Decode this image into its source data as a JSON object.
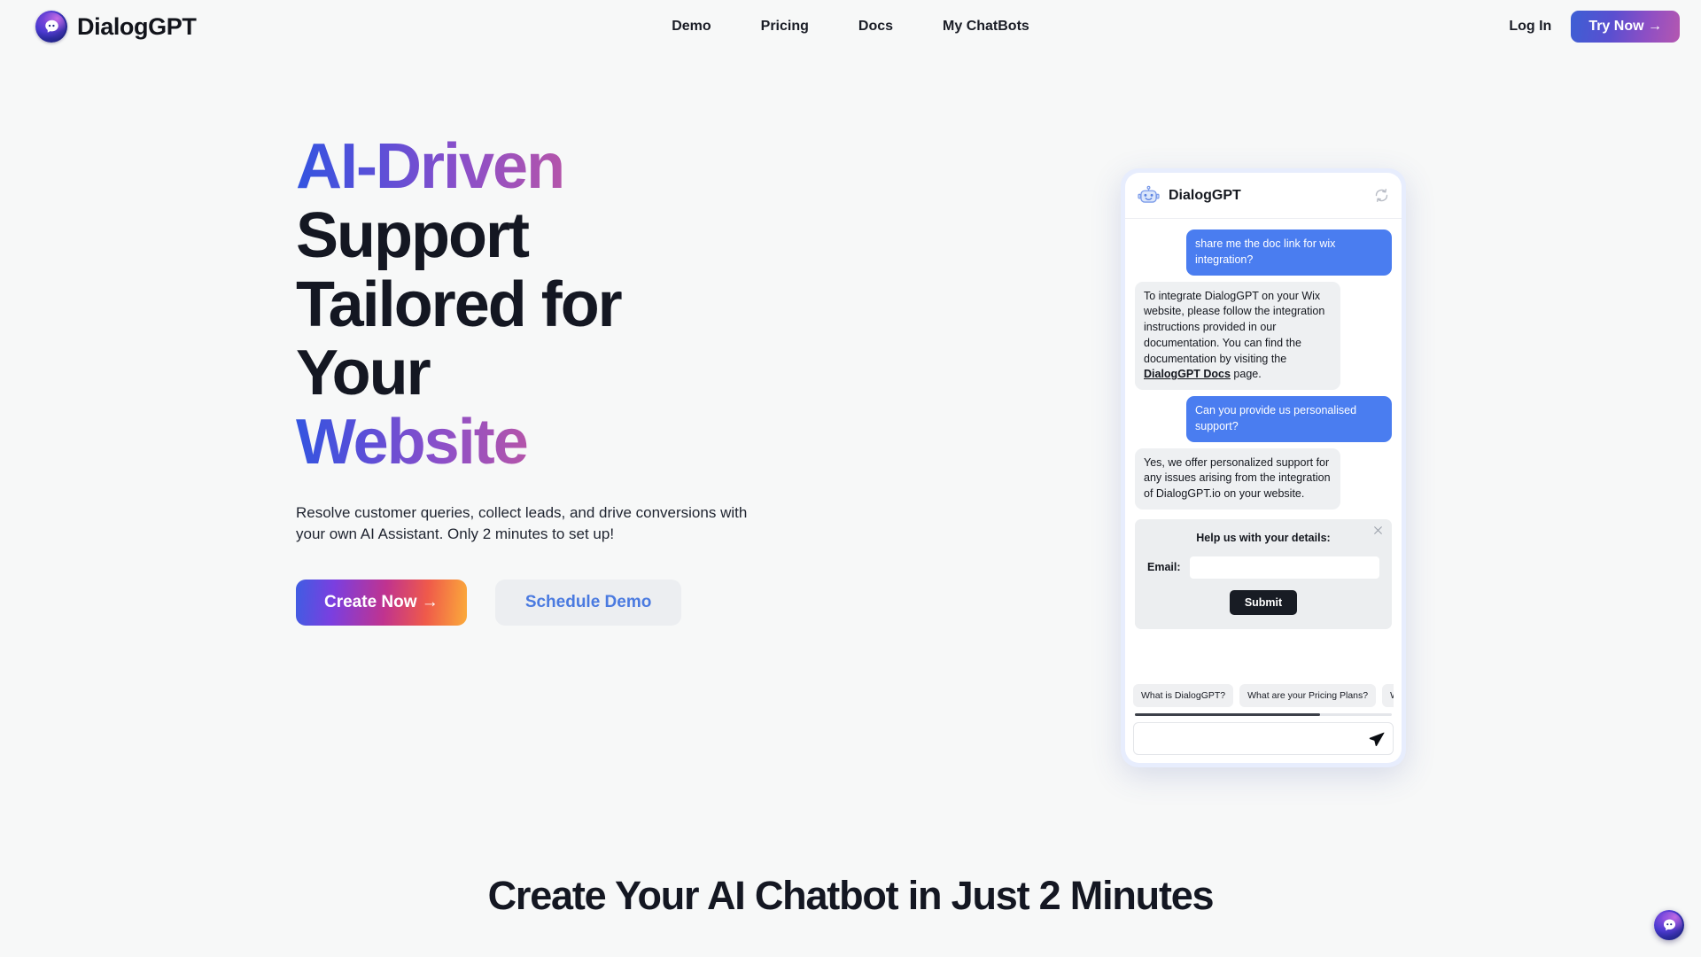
{
  "brand": {
    "name": "DialogGPT",
    "logo_icon": "chat-bubble-logo-icon"
  },
  "nav": {
    "items": [
      {
        "label": "Demo"
      },
      {
        "label": "Pricing"
      },
      {
        "label": "Docs"
      },
      {
        "label": "My ChatBots"
      }
    ],
    "login_label": "Log In",
    "cta_label": "Try Now →"
  },
  "hero": {
    "title_highlight": "AI-Driven",
    "title_rest_line1": " Support",
    "title_line2": "Tailored for Your",
    "title_highlight2": "Website",
    "subtitle": "Resolve customer queries, collect leads, and drive conversions with your own AI Assistant. Only 2 minutes to set up!",
    "primary_cta": "Create Now →",
    "secondary_cta": "Schedule Demo"
  },
  "chat_widget": {
    "header_title": "DialogGPT",
    "avatar_icon": "robot-avatar-icon",
    "refresh_icon": "refresh-icon",
    "messages": [
      {
        "role": "user",
        "text": "share me the doc link for wix integration?"
      },
      {
        "role": "bot",
        "text_before_link": "To integrate DialogGPT on your Wix website, please follow the integration instructions provided in our documentation. You can find the documentation by visiting the ",
        "link_text": "DialogGPT Docs",
        "text_after_link": " page."
      },
      {
        "role": "user",
        "text": "Can you provide us personalised support?"
      },
      {
        "role": "bot",
        "text": "Yes, we offer personalized support for any issues arising from the integration of DialogGPT.io on your website."
      }
    ],
    "lead_form": {
      "title": "Help us with your details:",
      "email_label": "Email:",
      "email_value": "",
      "email_placeholder": "",
      "submit_label": "Submit",
      "close_icon": "close-icon"
    },
    "quick_replies": [
      {
        "label": "What is DialogGPT?"
      },
      {
        "label": "What are your Pricing Plans?"
      },
      {
        "label": "Wha"
      }
    ],
    "input": {
      "value": "",
      "placeholder": "",
      "send_icon": "send-icon"
    }
  },
  "section_two": {
    "title": "Create Your AI Chatbot in Just 2 Minutes"
  },
  "launcher": {
    "icon": "chat-bubble-launcher-icon"
  },
  "colors": {
    "page_bg": "#f7f8f8",
    "accent_blue": "#3354e0",
    "accent_purple": "#b455aa",
    "user_bubble": "#4a7df0",
    "bot_bubble": "#eef0f2",
    "submit_dark": "#181c24",
    "link_blue": "#4a7ae0"
  }
}
